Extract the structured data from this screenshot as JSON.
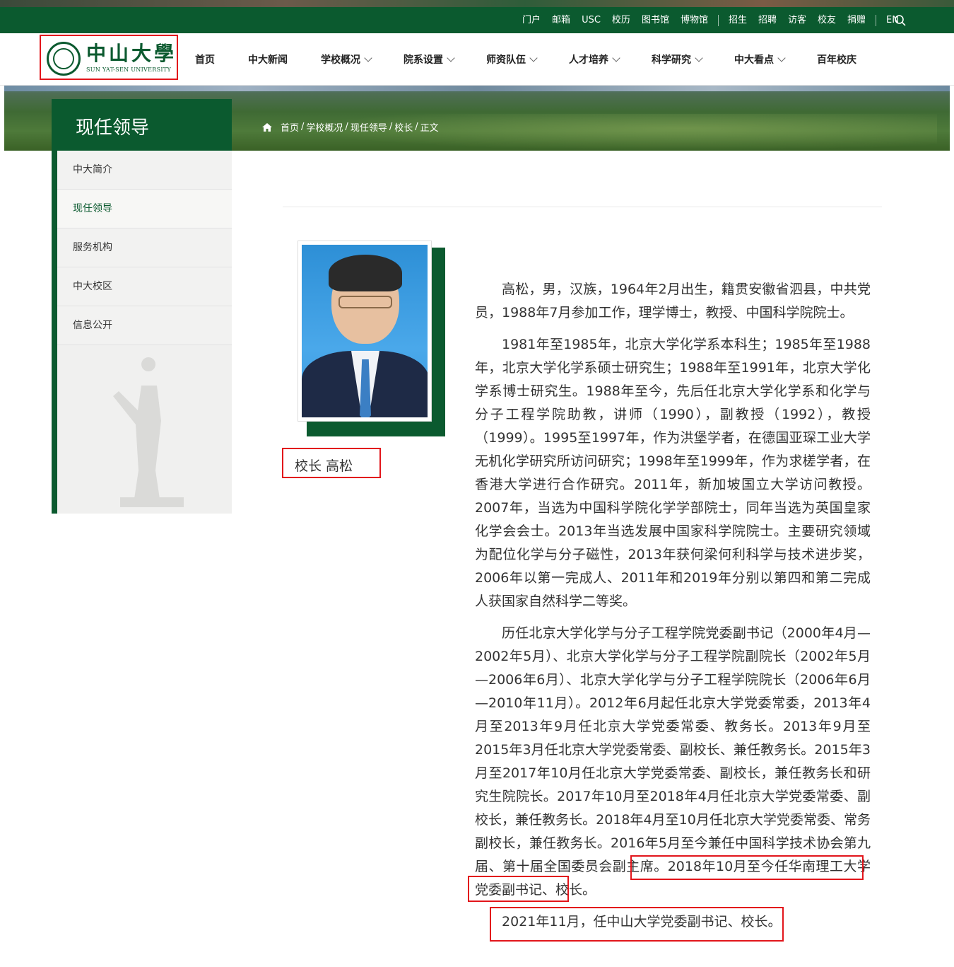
{
  "topbar": {
    "links": [
      "门户",
      "邮箱",
      "USC",
      "校历",
      "图书馆",
      "博物馆"
    ],
    "links2": [
      "招生",
      "招聘",
      "访客",
      "校友",
      "捐赠"
    ],
    "lang": "EN",
    "search_icon": "search-icon"
  },
  "logo": {
    "name_cn": "中山大學",
    "name_en": "SUN YAT-SEN UNIVERSITY"
  },
  "nav": {
    "items": [
      {
        "label": "首页",
        "has_dropdown": false
      },
      {
        "label": "中大新闻",
        "has_dropdown": false
      },
      {
        "label": "学校概况",
        "has_dropdown": true
      },
      {
        "label": "院系设置",
        "has_dropdown": true
      },
      {
        "label": "师资队伍",
        "has_dropdown": true
      },
      {
        "label": "人才培养",
        "has_dropdown": true
      },
      {
        "label": "科学研究",
        "has_dropdown": true
      },
      {
        "label": "中大看点",
        "has_dropdown": true
      },
      {
        "label": "百年校庆",
        "has_dropdown": false
      }
    ]
  },
  "banner": {
    "section_title": "现任领导",
    "breadcrumb": [
      "首页",
      "学校概况",
      "现任领导",
      "校长",
      "正文"
    ]
  },
  "sidebar": {
    "items": [
      {
        "label": "中大简介",
        "active": false
      },
      {
        "label": "现任领导",
        "active": true
      },
      {
        "label": "服务机构",
        "active": false
      },
      {
        "label": "中大校区",
        "active": false
      },
      {
        "label": "信息公开",
        "active": false
      }
    ]
  },
  "profile": {
    "caption": "校长 高松",
    "paragraphs": [
      "高松，男，汉族，1964年2月出生，籍贯安徽省泗县，中共党员，1988年7月参加工作，理学博士，教授、中国科学院院士。",
      "1981年至1985年，北京大学化学系本科生；1985年至1988年，北京大学化学系硕士研究生；1988年至1991年，北京大学化学系博士研究生。1988年至今，先后任北京大学化学系和化学与分子工程学院助教，讲师（1990），副教授（1992），教授（1999）。1995至1997年，作为洪堡学者，在德国亚琛工业大学无机化学研究所访问研究；1998年至1999年，作为求槎学者，在香港大学进行合作研究。2011年，新加坡国立大学访问教授。2007年，当选为中国科学院化学学部院士，同年当选为英国皇家化学会会士。2013年当选发展中国家科学院院士。主要研究领域为配位化学与分子磁性，2013年获何梁何利科学与技术进步奖，2006年以第一完成人、2011年和2019年分别以第四和第二完成人获国家自然科学二等奖。",
      "历任北京大学化学与分子工程学院党委副书记（2000年4月—2002年5月）、北京大学化学与分子工程学院副院长（2002年5月—2006年6月）、北京大学化学与分子工程学院院长（2006年6月—2010年11月）。2012年6月起任北京大学党委常委，2013年4月至2013年9月任北京大学党委常委、教务长。2013年9月至2015年3月任北京大学党委常委、副校长、兼任教务长。2015年3月至2017年10月任北京大学党委常委、副校长，兼任教务长和研究生院院长。2017年10月至2018年4月任北京大学党委常委、副校长，兼任教务长。2018年4月至10月任北京大学党委常委、常务副校长，兼任教务长。2016年5月至今兼任中国科学技术协会第九届、第十届全国委员会副主席。2018年10月至今任华南理工大学党委副书记、校长。",
      "2021年11月，任中山大学党委副书记、校长。"
    ]
  },
  "colors": {
    "brand_green": "#0b5a2f",
    "highlight_red": "#e2151b"
  }
}
